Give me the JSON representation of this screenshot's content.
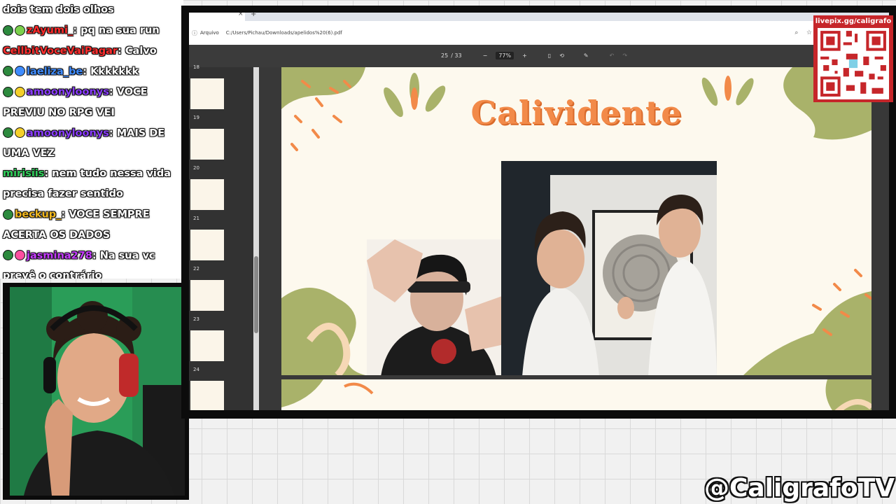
{
  "chat": {
    "messages": [
      {
        "user": "",
        "text": "dois tem dois olhos",
        "user_color": "#ffffff",
        "badges": []
      },
      {
        "user": "zAyumi_",
        "text": ": pq na sua run",
        "user_color": "#ff2a2a",
        "badges": [
          "#2d8a3e",
          "#7bd14d"
        ]
      },
      {
        "user": "CellbitVoceVaiPagar",
        "text": ": Calvo",
        "user_color": "#ff2e2e",
        "badges": []
      },
      {
        "user": "laeliza_be",
        "text": ": Kkkkkkk",
        "user_color": "#3f8cff",
        "badges": [
          "#2d8a3e",
          "#3f8cff"
        ]
      },
      {
        "user": "amoonyloonys",
        "text": ": VOCE",
        "user_color": "#8a3cff",
        "badges": [
          "#2d8a3e",
          "#f5d02a"
        ]
      },
      {
        "user": "",
        "text": "PREVIU NO RPG VEI",
        "user_color": "#ffffff",
        "badges": []
      },
      {
        "user": "amoonyloonys",
        "text": ": MAIS DE",
        "user_color": "#8a3cff",
        "badges": [
          "#2d8a3e",
          "#f5d02a"
        ]
      },
      {
        "user": "",
        "text": "UMA VEZ",
        "user_color": "#ffffff",
        "badges": []
      },
      {
        "user": "mirisiis",
        "text": ": nem tudo nessa vida",
        "user_color": "#2fcf5a",
        "badges": []
      },
      {
        "user": "",
        "text": "precisa fazer sentido",
        "user_color": "#ffffff",
        "badges": []
      },
      {
        "user": "beckup_",
        "text": ": VOCE SEMPRE",
        "user_color": "#f2b81e",
        "badges": [
          "#2d8a3e"
        ]
      },
      {
        "user": "",
        "text": "ACERTA OS DADOS",
        "user_color": "#ffffff",
        "badges": []
      },
      {
        "user": "jasmina278",
        "text": ": Na sua vc",
        "user_color": "#c53cff",
        "badges": [
          "#2d8a3e",
          "#ff4fa0"
        ]
      },
      {
        "user": "",
        "text": "prevê o contrário",
        "user_color": "#ffffff",
        "badges": []
      }
    ]
  },
  "browser": {
    "address_label": "Arquivo",
    "url": "C:/Users/Pichau/Downloads/apelidos%20(6).pdf"
  },
  "pdf_toolbar": {
    "page_current": "25",
    "page_total": "/ 33",
    "zoom": "77%",
    "zoom_out": "−",
    "zoom_in": "+"
  },
  "thumbnails": [
    {
      "num": "18"
    },
    {
      "num": "19"
    },
    {
      "num": "20"
    },
    {
      "num": "21"
    },
    {
      "num": "22"
    },
    {
      "num": "23"
    },
    {
      "num": "24"
    }
  ],
  "slide": {
    "title": "Calividente"
  },
  "overlay": {
    "qr_url": "livepix.gg/caligrafo",
    "handle": "@CaligrafoTV"
  },
  "colors": {
    "accent_orange": "#f28a49",
    "leaf_green": "#a9b26a",
    "qr_red": "#c6262a"
  }
}
